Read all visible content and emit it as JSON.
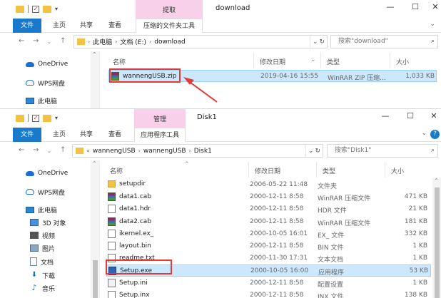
{
  "window1": {
    "context_tab": "提取",
    "title": "download",
    "ribbon_tabs": [
      "文件",
      "主页",
      "共享",
      "查看"
    ],
    "ribbon_context": "压缩的文件夹工具",
    "breadcrumb": [
      "此电脑",
      "文档 (E:)",
      "download"
    ],
    "search_placeholder": "搜索\"download\"",
    "columns": {
      "name": "名称",
      "date": "修改日期",
      "type": "类型",
      "size": "大小"
    },
    "files": [
      {
        "name": "wannengUSB.zip",
        "date": "2019-04-16 15:55",
        "type": "WinRAR ZIP 压缩...",
        "size": "1,033 KB",
        "icon": "rar-icon",
        "selected": true
      }
    ],
    "nav_pane": [
      {
        "label": "OneDrive",
        "icon": "onedrive-icon"
      },
      {
        "label": "WPS网盘",
        "icon": "wps-cloud-icon"
      },
      {
        "label": "此电脑",
        "icon": "this-pc-icon"
      }
    ]
  },
  "window2": {
    "context_tab": "管理",
    "title": "Disk1",
    "ribbon_tabs": [
      "文件",
      "主页",
      "共享",
      "查看"
    ],
    "ribbon_context": "应用程序工具",
    "breadcrumb_prefix": "«",
    "breadcrumb": [
      "wannengUSB",
      "wannengUSB",
      "Disk1"
    ],
    "search_placeholder": "搜索\"Disk1\"",
    "columns": {
      "name": "名称",
      "date": "修改日期",
      "type": "类型",
      "size": "大小"
    },
    "files": [
      {
        "name": "setupdir",
        "date": "2006-05-22 11:48",
        "type": "文件夹",
        "size": "",
        "icon": "folder"
      },
      {
        "name": "data1.cab",
        "date": "2000-12-11 8:58",
        "type": "WinRAR 压缩文件",
        "size": "471 KB",
        "icon": "rar"
      },
      {
        "name": "data1.hdr",
        "date": "2000-12-11 8:58",
        "type": "HDR 文件",
        "size": "21 KB",
        "icon": "file"
      },
      {
        "name": "data2.cab",
        "date": "2000-12-11 8:58",
        "type": "WinRAR 压缩文件",
        "size": "181 KB",
        "icon": "rar"
      },
      {
        "name": "ikernel.ex_",
        "date": "2000-10-05 16:01",
        "type": "EX_ 文件",
        "size": "332 KB",
        "icon": "file"
      },
      {
        "name": "layout.bin",
        "date": "2000-12-11 8:58",
        "type": "BIN 文件",
        "size": "1 KB",
        "icon": "file"
      },
      {
        "name": "readme.txt",
        "date": "2000-11-30 17:31",
        "type": "文本文档",
        "size": "1 KB",
        "icon": "file"
      },
      {
        "name": "Setup.exe",
        "date": "2000-10-05 16:00",
        "type": "应用程序",
        "size": "53 KB",
        "icon": "exe",
        "selected": true
      },
      {
        "name": "Setup.ini",
        "date": "2000-12-11 8:58",
        "type": "配置设置",
        "size": "1 KB",
        "icon": "ini"
      },
      {
        "name": "Setup.inx",
        "date": "2000-12-11 8:58",
        "type": "INX 文件",
        "size": "138 KB",
        "icon": "file"
      }
    ],
    "nav_pane": [
      {
        "label": "OneDrive",
        "icon": "onedrive-icon",
        "sub": false
      },
      {
        "label": "WPS网盘",
        "icon": "wps-cloud-icon",
        "sub": false
      },
      {
        "label": "此电脑",
        "icon": "this-pc-icon",
        "sub": false
      },
      {
        "label": "3D 对象",
        "icon": "3d-objects-icon",
        "sub": true
      },
      {
        "label": "视频",
        "icon": "video-icon",
        "sub": true
      },
      {
        "label": "图片",
        "icon": "pictures-icon",
        "sub": true
      },
      {
        "label": "文档",
        "icon": "documents-icon",
        "sub": true
      },
      {
        "label": "下载",
        "icon": "downloads-icon",
        "sub": true
      },
      {
        "label": "音乐",
        "icon": "music-icon",
        "sub": true
      }
    ]
  },
  "colors": {
    "accent": "#1979ca",
    "selection": "#cce8ff",
    "highlight": "#e53935",
    "context_tab": "#f8d0ea"
  }
}
